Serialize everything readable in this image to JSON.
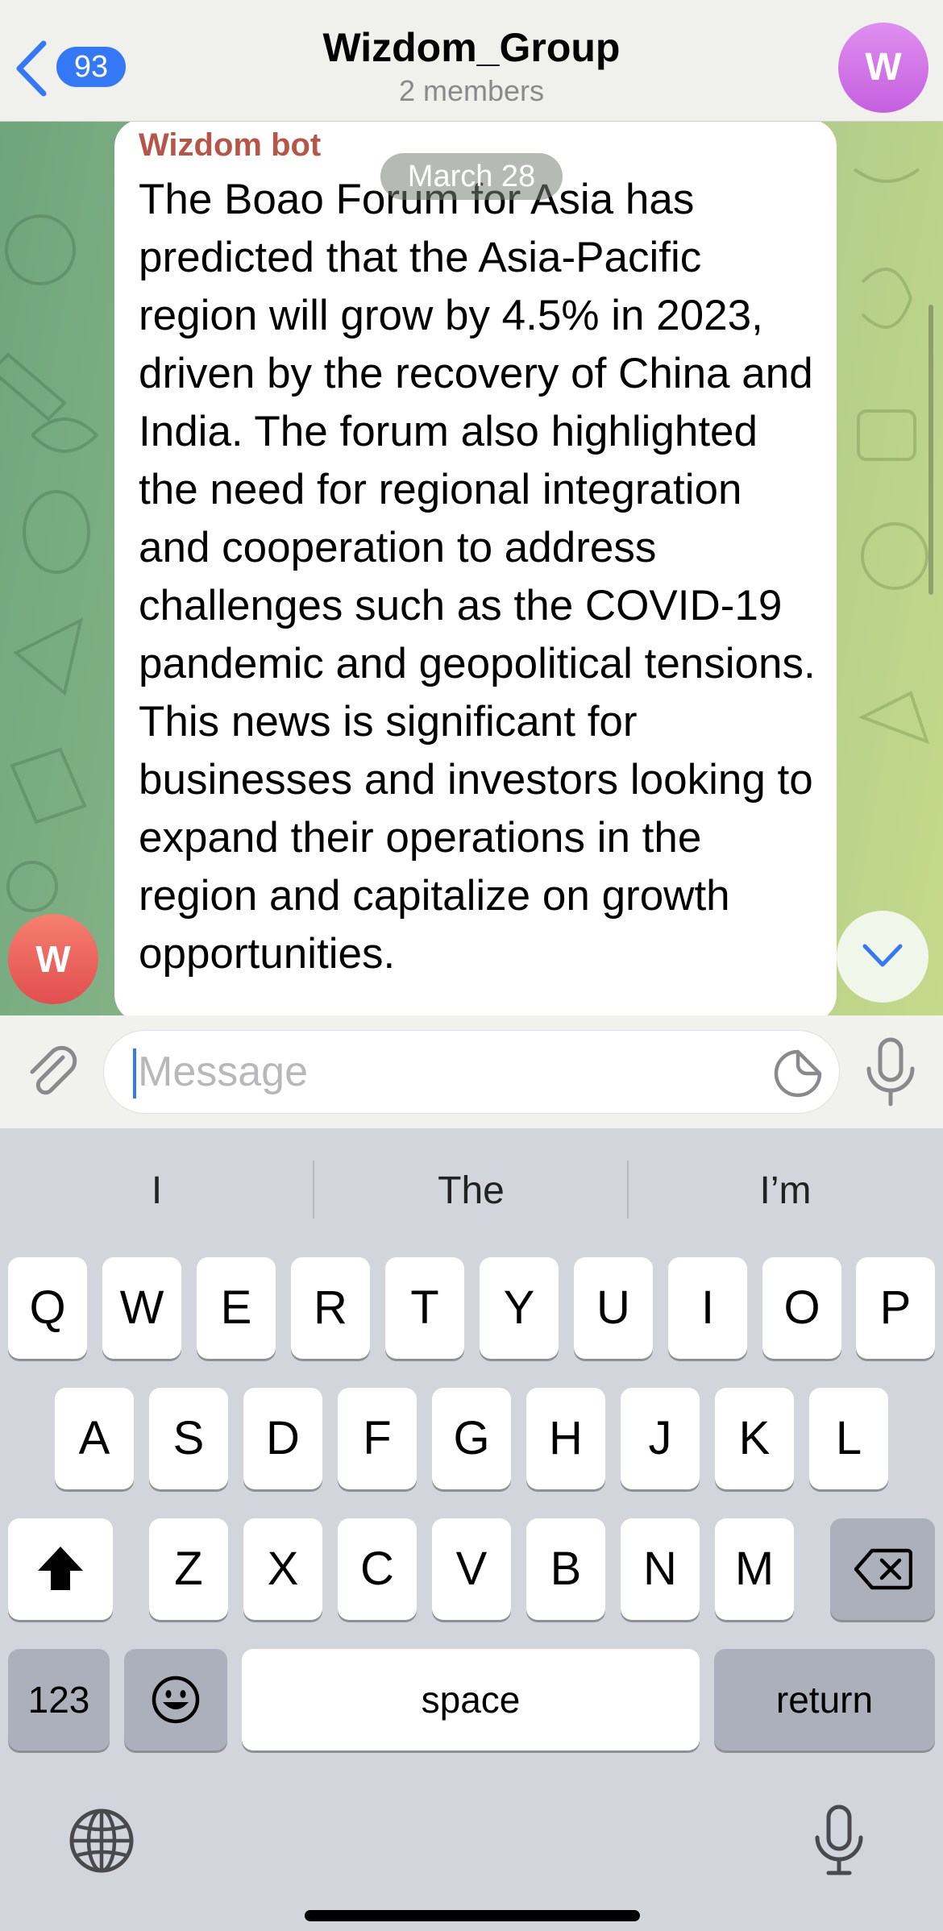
{
  "header": {
    "back_count": "93",
    "title": "Wizdom_Group",
    "subtitle": "2 members",
    "avatar_letter": "W"
  },
  "chat": {
    "date_label": "March 28",
    "message": {
      "sender": "Wizdom bot",
      "avatar_letter": "W",
      "text": "The Boao Forum for Asia has predicted that the Asia-Pacific region will grow by 4.5% in 2023, driven by the recovery of China and India. The forum also highlighted the need for regional integration and cooperation to address challenges such as the COVID-19 pandemic and geopolitical tensions. This news is significant for businesses and investors looking to expand their operations in the region and capitalize on growth opportunities."
    }
  },
  "input": {
    "placeholder": "Message",
    "value": ""
  },
  "keyboard": {
    "suggestions": [
      "I",
      "The",
      "I’m"
    ],
    "row1": [
      "Q",
      "W",
      "E",
      "R",
      "T",
      "Y",
      "U",
      "I",
      "O",
      "P"
    ],
    "row2": [
      "A",
      "S",
      "D",
      "F",
      "G",
      "H",
      "J",
      "K",
      "L"
    ],
    "row3": [
      "Z",
      "X",
      "C",
      "V",
      "B",
      "N",
      "M"
    ],
    "numbers_label": "123",
    "space_label": "space",
    "return_label": "return"
  },
  "icons": {
    "back": "chevron-left-icon",
    "attach": "paperclip-icon",
    "sticker": "sticker-icon",
    "mic": "microphone-icon",
    "scroll_down": "chevron-down-icon",
    "shift": "shift-arrow-icon",
    "delete": "backspace-icon",
    "emoji": "emoji-icon",
    "globe": "globe-icon",
    "dictation": "dictation-mic-icon"
  },
  "colors": {
    "accent": "#3478f6",
    "sender_name": "#b55648",
    "group_avatar": "#d07ae8",
    "sender_avatar": "#eb6461"
  }
}
